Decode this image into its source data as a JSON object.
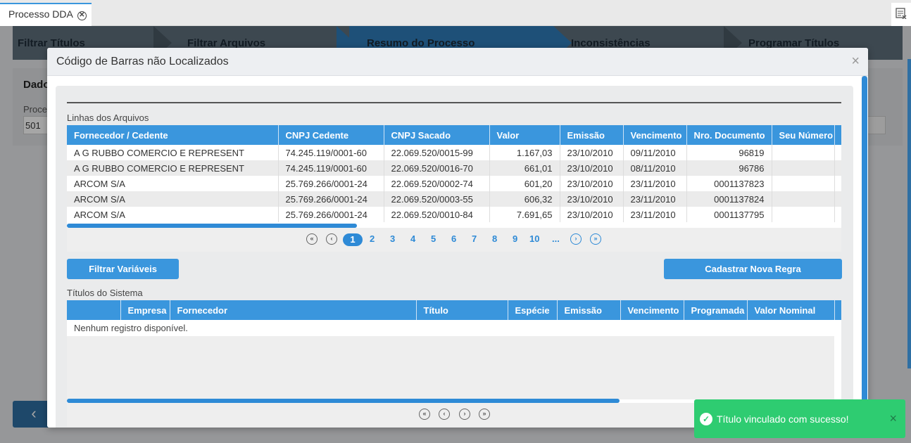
{
  "tab": {
    "label": "Processo DDA"
  },
  "wizard": {
    "steps": [
      "Filtrar Títulos",
      "Filtrar Arquivos",
      "Resumo do Processo",
      "Inconsistências",
      "Programar Títulos"
    ]
  },
  "background": {
    "panel_title": "Dado",
    "field_label": "Proce",
    "field_value": "501"
  },
  "modal": {
    "title": "Código de Barras não Localizados",
    "close_label": "×",
    "files_section_label": "Linhas dos Arquivos",
    "files_table": {
      "headers": [
        "Fornecedor / Cedente",
        "CNPJ Cedente",
        "CNPJ Sacado",
        "Valor",
        "Emissão",
        "Vencimento",
        "Nro. Documento",
        "Seu Número"
      ],
      "rows": [
        [
          "A G RUBBO COMERCIO E REPRESENT",
          "74.245.119/0001-60",
          "22.069.520/0015-99",
          "1.167,03",
          "23/10/2010",
          "09/11/2010",
          "96819",
          ""
        ],
        [
          "A G RUBBO COMERCIO E REPRESENT",
          "74.245.119/0001-60",
          "22.069.520/0016-70",
          "661,01",
          "23/10/2010",
          "08/11/2010",
          "96786",
          ""
        ],
        [
          "ARCOM S/A",
          "25.769.266/0001-24",
          "22.069.520/0002-74",
          "601,20",
          "23/10/2010",
          "23/11/2010",
          "0001137823",
          ""
        ],
        [
          "ARCOM S/A",
          "25.769.266/0001-24",
          "22.069.520/0003-55",
          "606,32",
          "23/10/2010",
          "23/11/2010",
          "0001137824",
          ""
        ],
        [
          "ARCOM S/A",
          "25.769.266/0001-24",
          "22.069.520/0010-84",
          "7.691,65",
          "23/10/2010",
          "23/11/2010",
          "0001137795",
          ""
        ]
      ]
    },
    "pager": {
      "pages": [
        "1",
        "2",
        "3",
        "4",
        "5",
        "6",
        "7",
        "8",
        "9",
        "10",
        "..."
      ],
      "current": "1"
    },
    "filter_button": "Filtrar Variáveis",
    "new_rule_button": "Cadastrar Nova Regra",
    "system_section_label": "Títulos do Sistema",
    "system_table": {
      "headers": [
        "",
        "Empresa",
        "Fornecedor",
        "Título",
        "Espécie",
        "Emissão",
        "Vencimento",
        "Programada",
        "Valor Nominal"
      ],
      "empty_message": "Nenhum registro disponível."
    }
  },
  "toast": {
    "message": "Título vinculado com sucesso!",
    "close_label": "×"
  },
  "colors": {
    "accent": "#3a96dd",
    "toast": "#2ecc71"
  }
}
